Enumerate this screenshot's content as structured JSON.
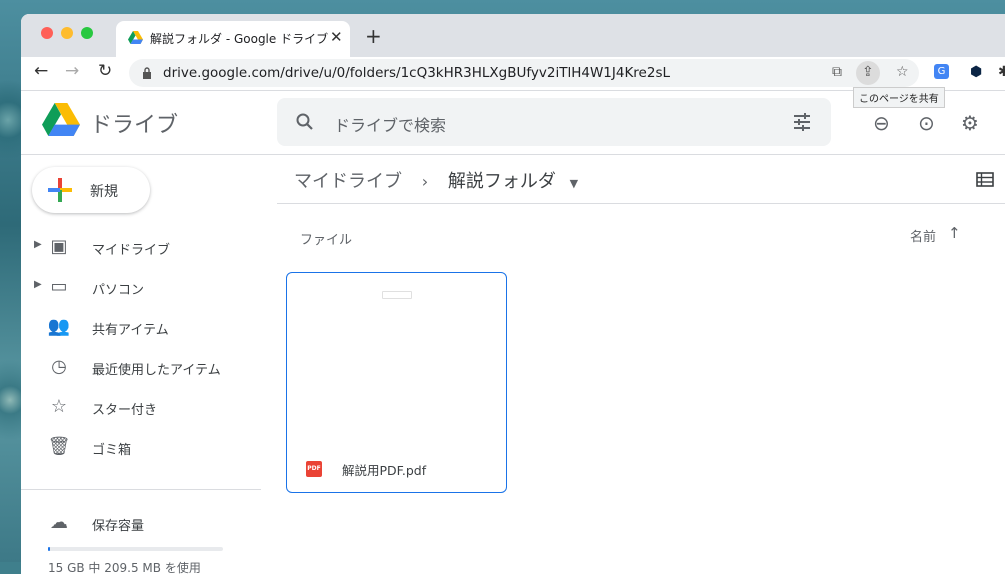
{
  "browser": {
    "tab_title": "解説フォルダ - Google ドライブ",
    "tab_close": "✕",
    "new_tab": "+",
    "url": "drive.google.com/drive/u/0/folders/1cQ3kHR3HLXgBUfyv2iTlH4W1J4Kre2sL",
    "tooltip": "このページを共有"
  },
  "header": {
    "app_name": "ドライブ",
    "search_placeholder": "ドライブで検索"
  },
  "sidebar": {
    "new_button": "新規",
    "items": [
      {
        "label": "マイドライブ",
        "icon": "my-drive-icon",
        "expandable": true
      },
      {
        "label": "パソコン",
        "icon": "computers-icon",
        "expandable": true
      },
      {
        "label": "共有アイテム",
        "icon": "shared-icon",
        "expandable": false
      },
      {
        "label": "最近使用したアイテム",
        "icon": "recent-icon",
        "expandable": false
      },
      {
        "label": "スター付き",
        "icon": "star-icon",
        "expandable": false
      },
      {
        "label": "ゴミ箱",
        "icon": "trash-icon",
        "expandable": false
      }
    ],
    "storage_label": "保存容量",
    "storage_text": "15 GB 中 209.5 MB を使用",
    "storage_used_fraction": 0.014
  },
  "main": {
    "breadcrumb_root": "マイドライブ",
    "breadcrumb_sep": "›",
    "breadcrumb_current": "解説フォルダ",
    "section_label": "ファイル",
    "sort_label": "名前",
    "files": [
      {
        "name": "解説用PDF.pdf",
        "type_badge": "PDF"
      }
    ]
  },
  "colors": {
    "accent": "#1a73e8",
    "pdf": "#ea4335",
    "tab_bar": "#dee1e6"
  }
}
